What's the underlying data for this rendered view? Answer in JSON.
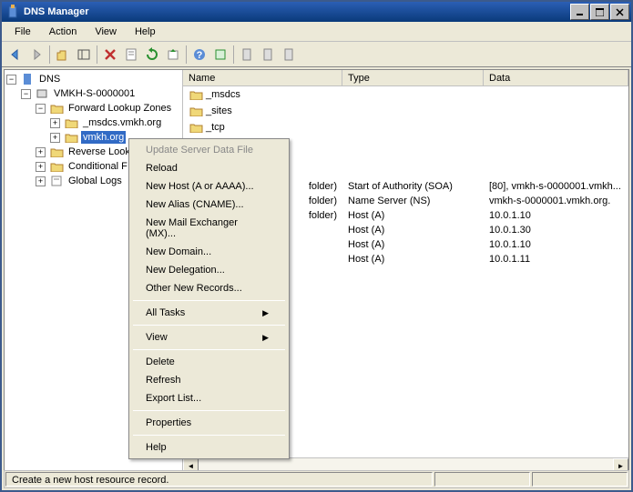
{
  "title": "DNS Manager",
  "menus": [
    "File",
    "Action",
    "View",
    "Help"
  ],
  "tree": {
    "root": "DNS",
    "server": "VMKH-S-0000001",
    "flz": "Forward Lookup Zones",
    "zone1": "_msdcs.vmkh.org",
    "zone2": "vmkh.org",
    "rlz": "Reverse Look",
    "cf": "Conditional F",
    "gl": "Global Logs"
  },
  "columns": {
    "name": "Name",
    "type": "Type",
    "data": "Data"
  },
  "rows": [
    {
      "name": "_msdcs",
      "type": "",
      "data": ""
    },
    {
      "name": "_sites",
      "type": "",
      "data": ""
    },
    {
      "name": "_tcp",
      "type": "",
      "data": ""
    },
    {
      "name": "",
      "type": "folder)",
      "data_t": "Start of Authority (SOA)",
      "data_d": "[80], vmkh-s-0000001.vmkh..."
    },
    {
      "name": "",
      "type": "folder)",
      "data_t": "Name Server (NS)",
      "data_d": "vmkh-s-0000001.vmkh.org."
    },
    {
      "name": "",
      "type": "folder)",
      "data_t": "Host (A)",
      "data_d": "10.0.1.10"
    },
    {
      "name": "",
      "type": "",
      "data_t": "Host (A)",
      "data_d": "10.0.1.30"
    },
    {
      "name": "",
      "type": "",
      "data_t": "Host (A)",
      "data_d": "10.0.1.10"
    },
    {
      "name": "",
      "type": "",
      "data_t": "Host (A)",
      "data_d": "10.0.1.11"
    }
  ],
  "ctx": {
    "update": "Update Server Data File",
    "reload": "Reload",
    "newhost": "New Host (A or AAAA)...",
    "newalias": "New Alias (CNAME)...",
    "newmx": "New Mail Exchanger (MX)...",
    "newdomain": "New Domain...",
    "newdeleg": "New Delegation...",
    "otherrec": "Other New Records...",
    "alltasks": "All Tasks",
    "view": "View",
    "delete": "Delete",
    "refresh": "Refresh",
    "export": "Export List...",
    "props": "Properties",
    "help": "Help"
  },
  "status": "Create a new host resource record."
}
